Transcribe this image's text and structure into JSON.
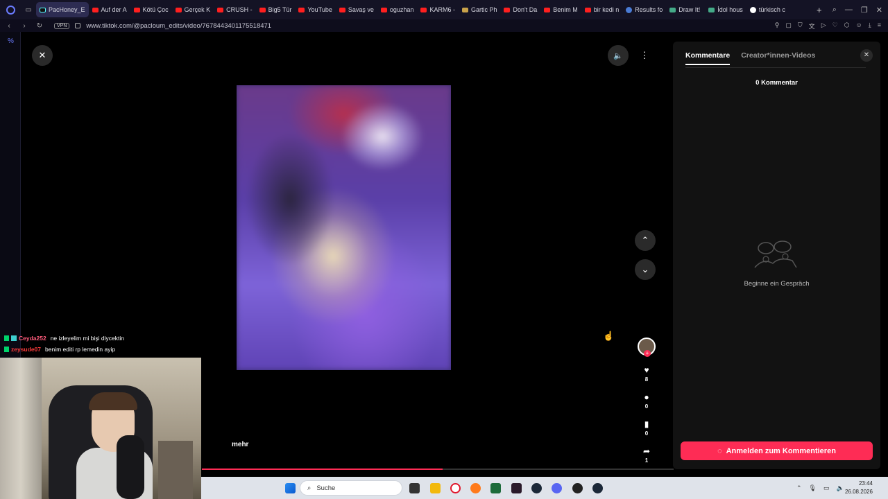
{
  "browser": {
    "tabs": [
      {
        "label": "PacHoney_E",
        "active": true,
        "icon": "tiktok"
      },
      {
        "label": "Auf der A",
        "icon": "youtube"
      },
      {
        "label": "Kötü Çoc",
        "icon": "youtube"
      },
      {
        "label": "Gerçek K",
        "icon": "youtube"
      },
      {
        "label": "CRUSH -",
        "icon": "youtube"
      },
      {
        "label": "Big5 Tür",
        "icon": "youtube"
      },
      {
        "label": "YouTube",
        "icon": "youtube"
      },
      {
        "label": "Savaş ve",
        "icon": "youtube"
      },
      {
        "label": "oguzhan",
        "icon": "youtube"
      },
      {
        "label": "KARM6 -",
        "icon": "youtube"
      },
      {
        "label": "Gartic Ph",
        "icon": "gartic"
      },
      {
        "label": "Don't Da",
        "icon": "youtube"
      },
      {
        "label": "Benim M",
        "icon": "youtube"
      },
      {
        "label": "bir kedi n",
        "icon": "w"
      },
      {
        "label": "Results fo",
        "icon": "globe"
      },
      {
        "label": "Draw It!",
        "icon": "draw"
      },
      {
        "label": "İdol hous",
        "icon": "idol"
      },
      {
        "label": "türkisch c",
        "icon": "google"
      }
    ],
    "vpn_label": "VPN",
    "url": "www.tiktok.com/@pacloum_edits/video/7678443401175518471"
  },
  "video": {
    "more_label": "mehr",
    "progress_fraction": 0.51,
    "actions": {
      "likes": "8",
      "comments": "0",
      "saves": "0",
      "shares": "1"
    }
  },
  "chat": [
    {
      "user": "Ceyda252",
      "message": "ne izleyelim mi bişi diycektin",
      "color": "#ff5c7c"
    },
    {
      "user": "zeysude07",
      "message": "benim editi rp lemedin ayip",
      "color": "#ff3b3b"
    }
  ],
  "panel": {
    "tab_comments": "Kommentare",
    "tab_creator": "Creator*innen-Videos",
    "comment_count": "0 Kommentar",
    "empty_text": "Beginne ein Gespräch",
    "login_button": "Anmelden zum Kommentieren"
  },
  "taskbar": {
    "search_placeholder": "Suche",
    "time": "23:44",
    "date": "26.08.2026"
  },
  "colors": {
    "accent": "#fe2c55",
    "panel_bg": "#121212",
    "tabbar_bg": "#141325"
  }
}
